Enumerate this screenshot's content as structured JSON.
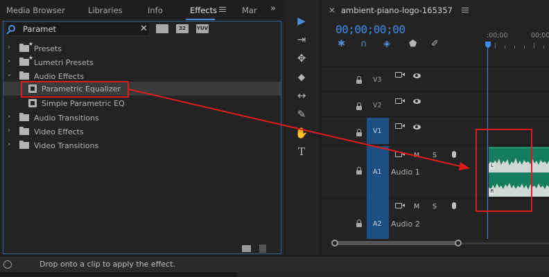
{
  "effects_panel": {
    "tabs": [
      {
        "label": "Media Browser"
      },
      {
        "label": "Libraries"
      },
      {
        "label": "Info"
      },
      {
        "label": "Effects"
      },
      {
        "label": "Mar"
      }
    ],
    "search": {
      "value": "Paramet",
      "placeholder": ""
    },
    "filter_buttons": [
      "",
      "32",
      "YUV"
    ],
    "tree": [
      {
        "label": "Presets",
        "type": "folder-star"
      },
      {
        "label": "Lumetri Presets",
        "type": "folder-star"
      },
      {
        "label": "Audio Effects",
        "type": "folder-open"
      },
      {
        "label": "Parametric Equalizer",
        "type": "effect",
        "selected": true
      },
      {
        "label": "Simple Parametric EQ",
        "type": "effect"
      },
      {
        "label": "Audio Transitions",
        "type": "folder"
      },
      {
        "label": "Video Effects",
        "type": "folder"
      },
      {
        "label": "Video Transitions",
        "type": "folder"
      }
    ]
  },
  "tools": {
    "selection_icon": "arrow-cursor-icon",
    "items": [
      "▶",
      "⇥",
      "✥",
      "⬥",
      "↔",
      "✎",
      "✋",
      "T"
    ]
  },
  "timeline": {
    "sequence_name": "ambient-piano-logo-165357",
    "timecode": "00;00;00;00",
    "ruler_labels": [
      ":00;00",
      "00;00"
    ],
    "tracks": [
      {
        "label": "V3",
        "type": "video"
      },
      {
        "label": "V2",
        "type": "video"
      },
      {
        "label": "V1",
        "type": "video"
      },
      {
        "label": "A1",
        "name": "Audio 1",
        "type": "audio",
        "mute": "M",
        "solo": "S"
      },
      {
        "label": "A2",
        "name": "Audio 2",
        "type": "audio",
        "mute": "M",
        "solo": "S"
      }
    ],
    "clip_channels": [
      "L",
      "R"
    ]
  },
  "status_bar": {
    "text": "Drop onto a clip to apply the effect."
  },
  "colors": {
    "accent": "#3f8be8",
    "annotation": "#e01b1b",
    "audio_clip": "#1d8a6a"
  }
}
